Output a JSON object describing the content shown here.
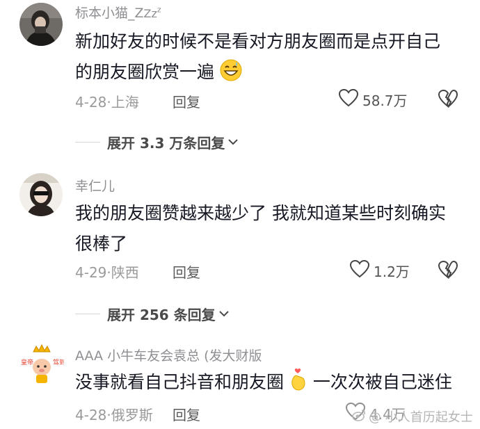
{
  "comments": [
    {
      "username": "标本小猫_Z",
      "username_suffix": "Zz",
      "username_super": "z",
      "text_line1": "新加好友的时候不是看对方朋友圈而是点开自己",
      "text_line2": "的朋友圈欣赏一遍",
      "emoji": "grinning-face-with-sweat-emoji",
      "date": "4-28",
      "location": "上海",
      "reply_label": "回复",
      "likes": "58.7万",
      "expand_label": "展开 3.3 万条回复"
    },
    {
      "username": "幸仁儿",
      "text_line1": "我的朋友圈赞越来越少了  我就知道某些时刻确实",
      "text_line2": "很棒了",
      "date": "4-29",
      "location": "陕西",
      "reply_label": "回复",
      "likes": "1.2万",
      "expand_label": "展开 256 条回复"
    },
    {
      "username": "AAA 小牛车友会袁总 (发大财版",
      "avatar_text_left": "皇帝",
      "avatar_text_right": "驾到",
      "text_before_emoji": "没事就看自己抖音和朋友圈",
      "emoji": "hand-with-heart-emoji",
      "text_after_emoji": "一次次被自己迷住",
      "date": "4-28",
      "location": "俄罗斯",
      "reply_label": "回复",
      "likes": "4.4万"
    }
  ],
  "watermark": "@ 小人首历起女士",
  "colors": {
    "text": "#161823",
    "secondary": "#8e8e93",
    "accent_avatar": "#e8412c"
  }
}
